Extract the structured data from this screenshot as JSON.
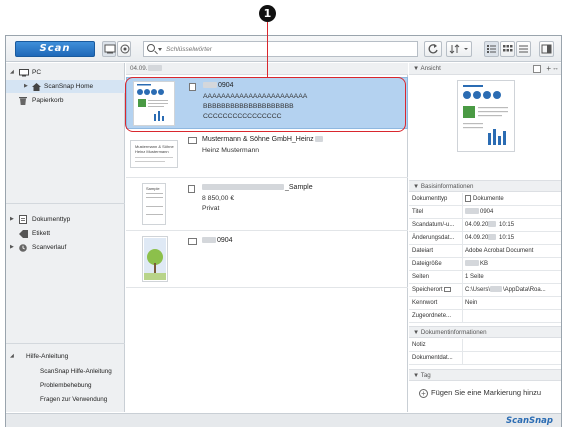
{
  "callout": {
    "number": "1"
  },
  "toolbar": {
    "scan_label": "Scan",
    "search_placeholder": "Schlüsselwörter"
  },
  "left_pane": {
    "tree": [
      {
        "label": "PC",
        "icon": "monitor-icon"
      },
      {
        "label": "ScanSnap Home",
        "icon": "home-icon"
      },
      {
        "label": "Papierkorb",
        "icon": "trash-icon"
      }
    ],
    "filters": [
      {
        "label": "Dokumenttyp",
        "icon": "document-type-icon"
      },
      {
        "label": "Etikett",
        "icon": "tag-icon"
      },
      {
        "label": "Scanverlauf",
        "icon": "history-icon"
      }
    ],
    "help": {
      "title": "Hilfe-Anleitung",
      "items": [
        "ScanSnap Hilfe-Anleitung",
        "Problembehebung",
        "Fragen zur Verwendung"
      ]
    }
  },
  "middle_pane": {
    "group_date": "04.09.",
    "docs": [
      {
        "title": "0904",
        "line2": "AAAAAAAAAAAAAAAAAAAAAAA",
        "line3": "BBBBBBBBBBBBBBBBBBBB",
        "line4": "CCCCCCCCCCCCCCCC"
      },
      {
        "title": "Mustermann & Söhne GmbH_Heinz",
        "line2": "Heinz Mustermann",
        "thumb_line1": "Mustermann & Söhne",
        "thumb_line2": "Heinz Mustermann"
      },
      {
        "title": "_Sample",
        "line2": "8 850,00 €",
        "line3": "Privat",
        "thumb_title": "Sample"
      },
      {
        "title": "0904"
      }
    ]
  },
  "right_pane": {
    "view_label": "Ansicht",
    "basic_header": "Basisinformationen",
    "basic": [
      {
        "key": "Dokumenttyp",
        "value": "Dokumente"
      },
      {
        "key": "Titel",
        "value": "0904"
      },
      {
        "key": "Scandatum/-u...",
        "value_pre": "04.09.20",
        "value_post": " 10:15"
      },
      {
        "key": "Änderungsdat...",
        "value_pre": "04.09.20",
        "value_post": " 10:15"
      },
      {
        "key": "Dateiart",
        "value": "Adobe Acrobat Document"
      },
      {
        "key": "Dateigröße",
        "value": "KB"
      },
      {
        "key": "Seiten",
        "value": "1 Seite"
      },
      {
        "key": "Speicherort",
        "value_pre": "C:\\Users\\",
        "value_post": "\\AppData\\Roa..."
      },
      {
        "key": "Kennwort",
        "value": "Nein"
      },
      {
        "key": "Zugeordnete...",
        "value": ""
      }
    ],
    "doc_info_header": "Dokumentinformationen",
    "doc_info": [
      {
        "key": "Notiz",
        "value": ""
      },
      {
        "key": "Dokumentdat...",
        "value": ""
      }
    ],
    "tag_header": "Tag",
    "add_tag_label": "Fügen Sie eine Markierung hinzu"
  },
  "status_bar": {
    "brand": "ScanSnap"
  }
}
